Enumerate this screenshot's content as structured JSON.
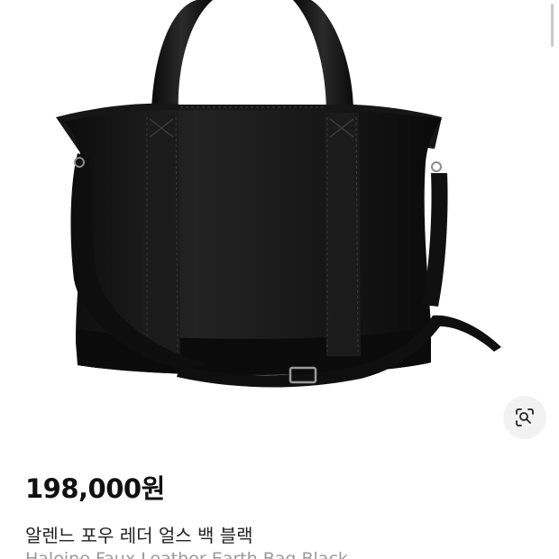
{
  "product": {
    "price": "198,000원",
    "title_ko": "알렌느 포우 레더 얼스 백 블랙",
    "title_en": "Haleine Faux Leather Earth Bag Black"
  },
  "icons": {
    "lens": "visual-search-lens-icon"
  },
  "colors": {
    "bag": "#141414",
    "title_en": "#9a9a9a",
    "lens_bg": "#f2f2f2"
  }
}
